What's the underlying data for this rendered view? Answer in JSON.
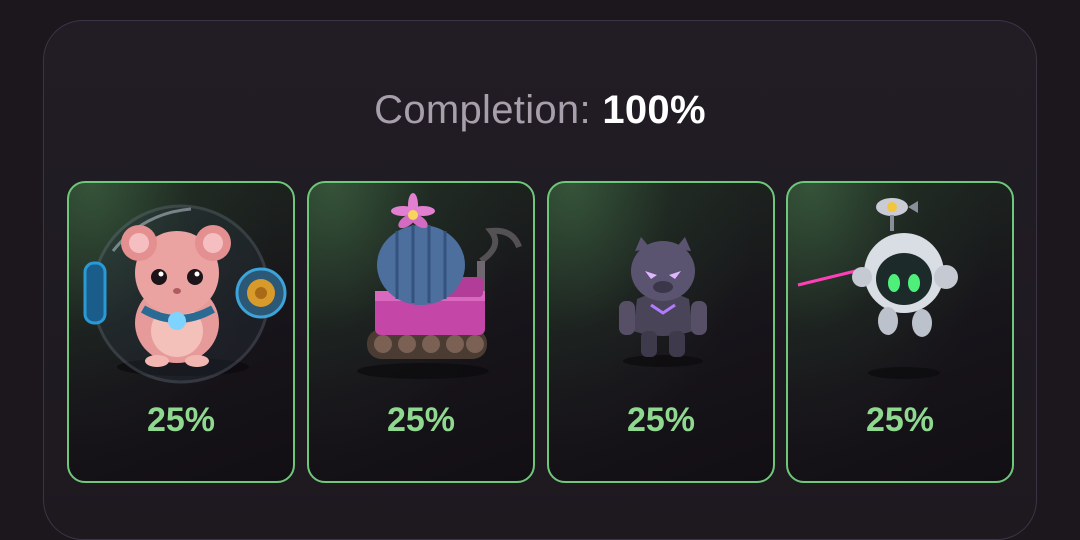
{
  "header": {
    "completion_label": "Completion:",
    "completion_value": "100%"
  },
  "cards": [
    {
      "icon": "hamster-ball-icon",
      "percent": "25%"
    },
    {
      "icon": "cactus-tank-icon",
      "percent": "25%"
    },
    {
      "icon": "panther-warrior-icon",
      "percent": "25%"
    },
    {
      "icon": "laser-robot-icon",
      "percent": "25%"
    }
  ],
  "colors": {
    "accent_green": "#6fc779",
    "percent_text": "#8ed88f",
    "background": "#1b171d"
  }
}
